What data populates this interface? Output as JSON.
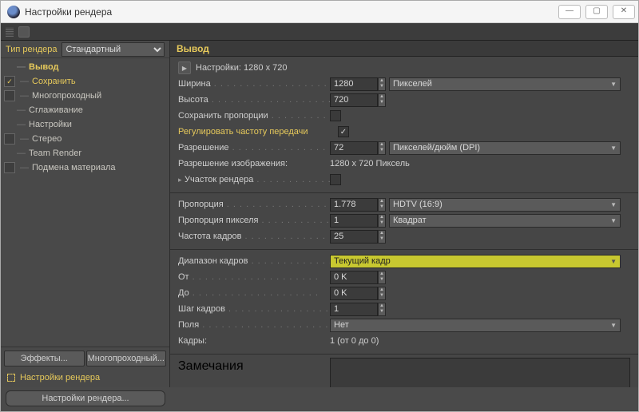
{
  "window": {
    "title": "Настройки рендера"
  },
  "sidebar": {
    "rendererLabel": "Тип рендера",
    "rendererValue": "Стандартный",
    "items": [
      {
        "label": "Вывод",
        "active": true,
        "check": "none"
      },
      {
        "label": "Сохранить",
        "check": "on"
      },
      {
        "label": "Многопроходный",
        "check": "off"
      },
      {
        "label": "Сглаживание",
        "check": "none"
      },
      {
        "label": "Настройки",
        "check": "none"
      },
      {
        "label": "Стерео",
        "check": "off"
      },
      {
        "label": "Team Render",
        "check": "none"
      },
      {
        "label": "Подмена материала",
        "check": "off"
      }
    ],
    "effectsBtn": "Эффекты...",
    "multipassBtn": "Многопроходный...",
    "statusLabel": "Настройки рендера"
  },
  "main": {
    "title": "Вывод",
    "presetLine": "Настройки: 1280 x 720",
    "width": {
      "label": "Ширина",
      "value": "1280",
      "unit": "Пикселей"
    },
    "height": {
      "label": "Высота",
      "value": "720"
    },
    "lockRatio": {
      "label": "Сохранить пропорции",
      "checked": false
    },
    "adaptRate": {
      "label": "Регулировать частоту передачи",
      "checked": true
    },
    "resolution": {
      "label": "Разрешение",
      "value": "72",
      "unit": "Пикселей/дюйм (DPI)"
    },
    "imageRes": {
      "label": "Разрешение изображения:",
      "value": "1280 x 720 Пиксель"
    },
    "region": {
      "label": "Участок рендера",
      "checked": false
    },
    "aspect": {
      "label": "Пропорция",
      "value": "1.778",
      "preset": "HDTV (16:9)"
    },
    "pixelAspect": {
      "label": "Пропорция пикселя",
      "value": "1",
      "preset": "Квадрат"
    },
    "fps": {
      "label": "Частота кадров",
      "value": "25"
    },
    "frameRange": {
      "label": "Диапазон кадров",
      "value": "Текущий кадр"
    },
    "from": {
      "label": "От",
      "value": "0 K"
    },
    "to": {
      "label": "До",
      "value": "0 K"
    },
    "step": {
      "label": "Шаг кадров",
      "value": "1"
    },
    "fields": {
      "label": "Поля",
      "value": "Нет"
    },
    "frames": {
      "label": "Кадры:",
      "value": "1 (от 0 до 0)"
    },
    "notes": {
      "label": "Замечания"
    }
  },
  "footer": {
    "button": "Настройки рендера..."
  }
}
